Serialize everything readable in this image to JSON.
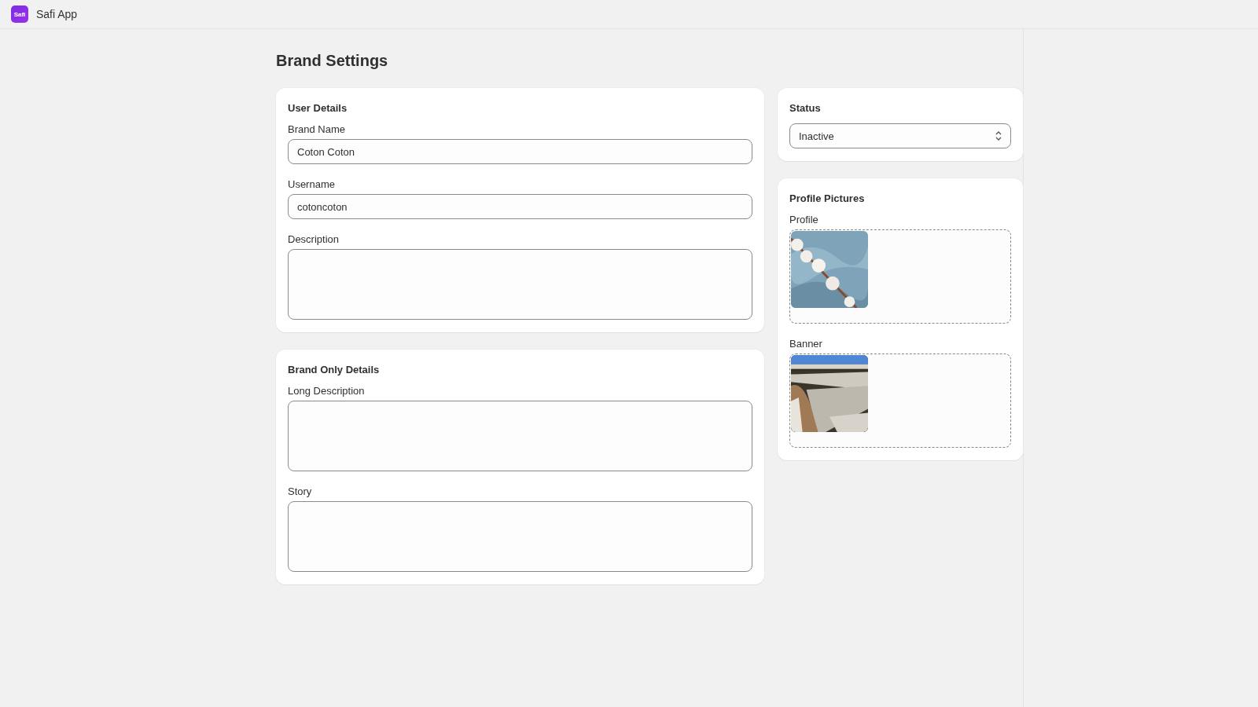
{
  "app": {
    "logo_text": "Safi",
    "name": "Safi App"
  },
  "page_title": "Brand Settings",
  "user_details": {
    "title": "User Details",
    "fields": [
      {
        "kind": "input",
        "label": "Brand Name",
        "value": "Coton Coton"
      },
      {
        "kind": "input",
        "label": "Username",
        "value": "cotoncoton"
      },
      {
        "kind": "textarea",
        "label": "Description"
      }
    ]
  },
  "brand_only_details": {
    "title": "Brand Only Details",
    "fields": [
      {
        "kind": "textarea",
        "label": "Long Description"
      },
      {
        "kind": "textarea",
        "label": "Story"
      }
    ]
  },
  "status": {
    "title": "Status",
    "value": "Inactive"
  },
  "profile_pictures": {
    "title": "Profile Pictures",
    "items": [
      {
        "label": "Profile",
        "kind": "cloth"
      },
      {
        "label": "Banner",
        "kind": "field"
      }
    ]
  }
}
